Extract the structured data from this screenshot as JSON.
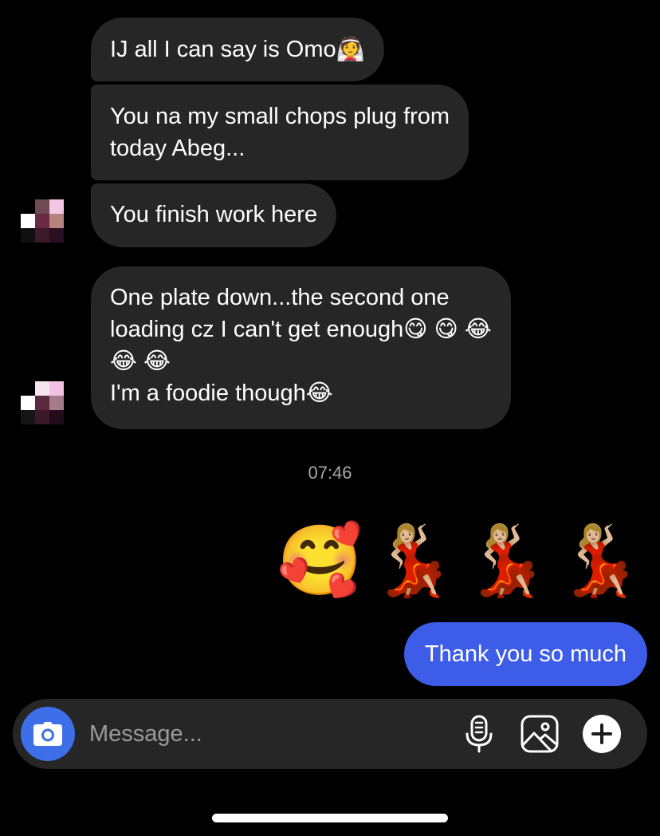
{
  "conversation": {
    "incoming": [
      {
        "text": "IJ all I can say is Omo👰"
      },
      {
        "text": "You na my small chops plug from\ntoday Abeg..."
      },
      {
        "text": "You finish work here"
      },
      {
        "text": "One plate down...the second one\nloading cz I can't get enough😋 😋 😂\n😂 😂\nI'm a foodie though😂"
      }
    ],
    "timestamp": "07:46",
    "outgoing_emojis": [
      "🥰",
      "💃🏼",
      "💃🏼",
      "💃🏼"
    ],
    "outgoing_text": "Thank you so much"
  },
  "composer": {
    "placeholder": "Message...",
    "camera_icon": "camera-icon",
    "mic_icon": "microphone-icon",
    "gallery_icon": "gallery-icon",
    "plus_icon": "plus-icon"
  },
  "colors": {
    "background": "#000000",
    "incoming_bubble": "#262626",
    "outgoing_bubble": "#3d5ce8",
    "camera_button": "#3d6fe8",
    "timestamp": "#a8a8a8"
  }
}
